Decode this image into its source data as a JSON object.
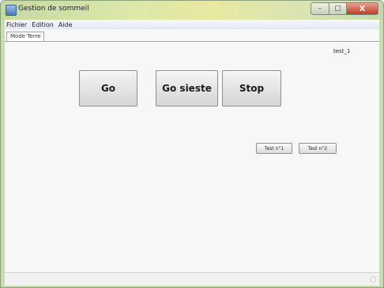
{
  "window": {
    "title": "Gestion de sommeil",
    "controls": {
      "minimize": "–",
      "maximize": "□",
      "close": "X"
    }
  },
  "menu": {
    "items": [
      "Fichier",
      "Edition",
      "Aide"
    ]
  },
  "tabs": [
    {
      "label": "Mode Terre"
    }
  ],
  "panel": {
    "corner_label": "test_1",
    "buttons": {
      "go": "Go",
      "go_sieste": "Go sieste",
      "stop": "Stop",
      "test1": "Test n°1",
      "test2": "Test n°2"
    }
  },
  "icons": {
    "app": "app-icon",
    "resize_grip": "resize-grip-icon"
  },
  "colors": {
    "titlebar": "#dce8a8",
    "close_button": "#c23a24",
    "panel_background": "#f7f7f7"
  }
}
